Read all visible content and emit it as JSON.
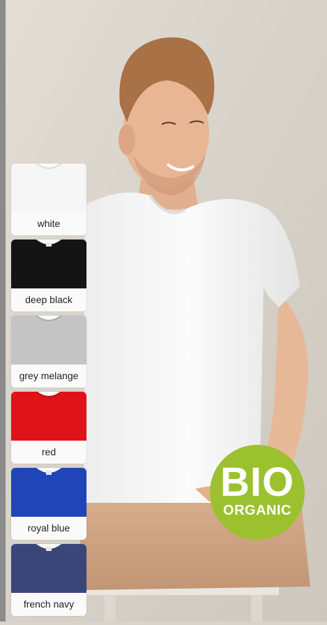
{
  "colors": {
    "background": "#d9d4cb",
    "badge_green": "#9bc12f"
  },
  "swatches": [
    {
      "label": "white",
      "color": "#f6f6f6"
    },
    {
      "label": "deep black",
      "color": "#141414"
    },
    {
      "label": "grey melange",
      "color": "#c4c4c4"
    },
    {
      "label": "red",
      "color": "#e0121a"
    },
    {
      "label": "royal blue",
      "color": "#1f45b8"
    },
    {
      "label": "french navy",
      "color": "#3b4678"
    }
  ],
  "badge": {
    "main": "BIO",
    "sub": "ORGANIC"
  }
}
